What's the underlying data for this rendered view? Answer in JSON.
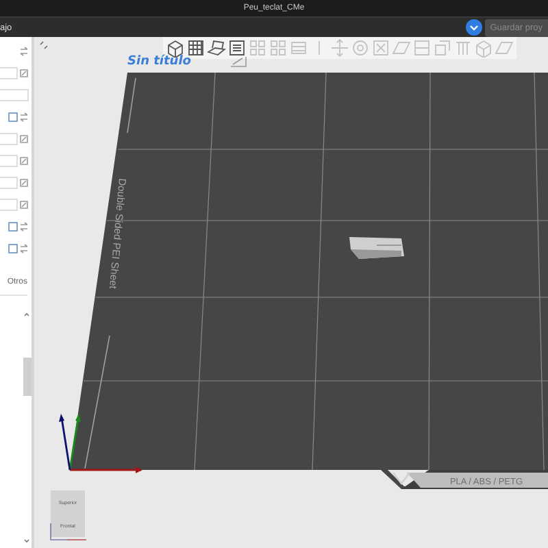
{
  "window": {
    "title": "Peu_teclat_CMe"
  },
  "menu_bar": {
    "tab": "ajo",
    "toggle": {
      "on": true
    },
    "save_button": {
      "label": "Guardar proy",
      "disabled": true
    }
  },
  "sidebar": {
    "rows": [
      {
        "kind": "icon-right"
      },
      {
        "kind": "field-edit"
      },
      {
        "kind": "field"
      },
      {
        "kind": "icon-pair"
      },
      {
        "kind": "field-edit"
      },
      {
        "kind": "field-edit"
      },
      {
        "kind": "field-edit"
      },
      {
        "kind": "field-edit"
      },
      {
        "kind": "icon-pair"
      },
      {
        "kind": "icon-pair"
      }
    ],
    "section_label": "Otros"
  },
  "toolbar": [
    {
      "kind": "cube",
      "disabled": false
    },
    {
      "kind": "grid",
      "disabled": false
    },
    {
      "kind": "layers",
      "disabled": false
    },
    {
      "kind": "preview",
      "disabled": false
    },
    {
      "kind": "cells",
      "disabled": true
    },
    {
      "kind": "cells",
      "disabled": true
    },
    {
      "kind": "list",
      "disabled": true
    },
    {
      "kind": "bar",
      "disabled": true
    },
    {
      "kind": "move",
      "disabled": true
    },
    {
      "kind": "rotate",
      "disabled": true
    },
    {
      "kind": "scale",
      "disabled": true
    },
    {
      "kind": "plane",
      "disabled": true
    },
    {
      "kind": "cut",
      "disabled": true
    },
    {
      "kind": "copy",
      "disabled": true
    },
    {
      "kind": "support",
      "disabled": true
    },
    {
      "kind": "cube",
      "disabled": true
    },
    {
      "kind": "plane",
      "disabled": true
    }
  ],
  "viewport": {
    "project_title": "Sin título",
    "bed_label": "Double Sided PEI Sheet",
    "filament_label": "PLA / ABS / PETG",
    "view_cube": {
      "top": "Superior",
      "front": "Frontal"
    }
  }
}
